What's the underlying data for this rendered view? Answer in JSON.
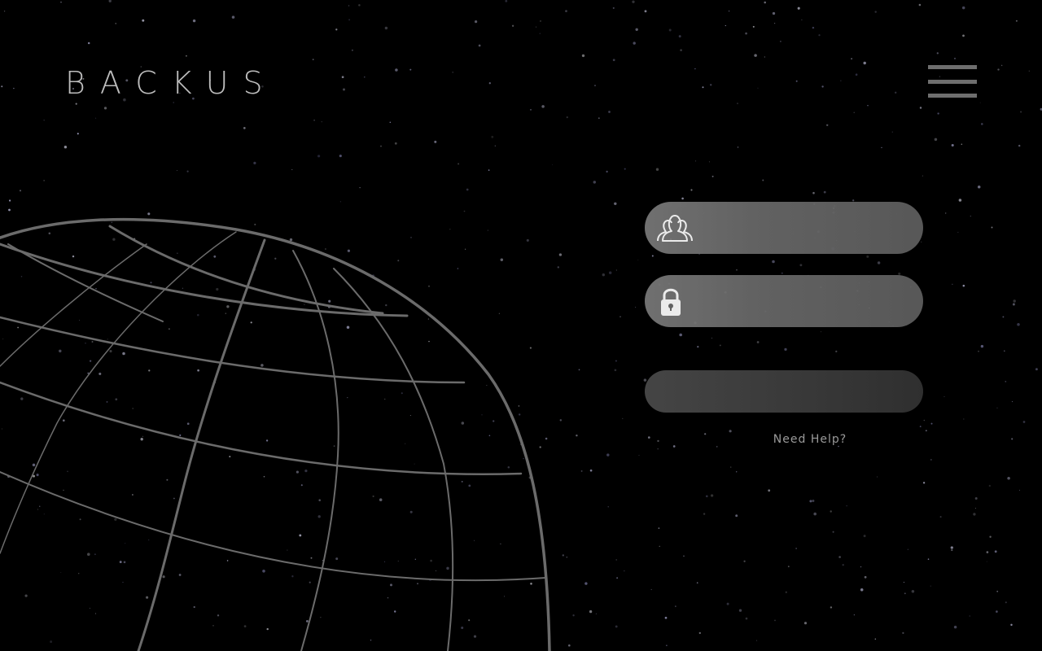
{
  "brand": {
    "logo_text": "BACKUS"
  },
  "header": {
    "menu_icon": "hamburger-menu-icon"
  },
  "login_form": {
    "username": {
      "icon": "users-group-icon",
      "value": "",
      "placeholder": ""
    },
    "password": {
      "icon": "padlock-icon",
      "value": "",
      "placeholder": ""
    },
    "submit_label": "",
    "help_link": "Need Help?"
  },
  "background": {
    "globe_icon": "wireframe-globe-graphic"
  },
  "colors": {
    "background": "#000000",
    "logo": "#bdbdbd",
    "field": "#6a6a6a",
    "button": "#3a3a3a",
    "help_text": "#9a9a9a",
    "globe_lines": "#6b6b6b"
  }
}
